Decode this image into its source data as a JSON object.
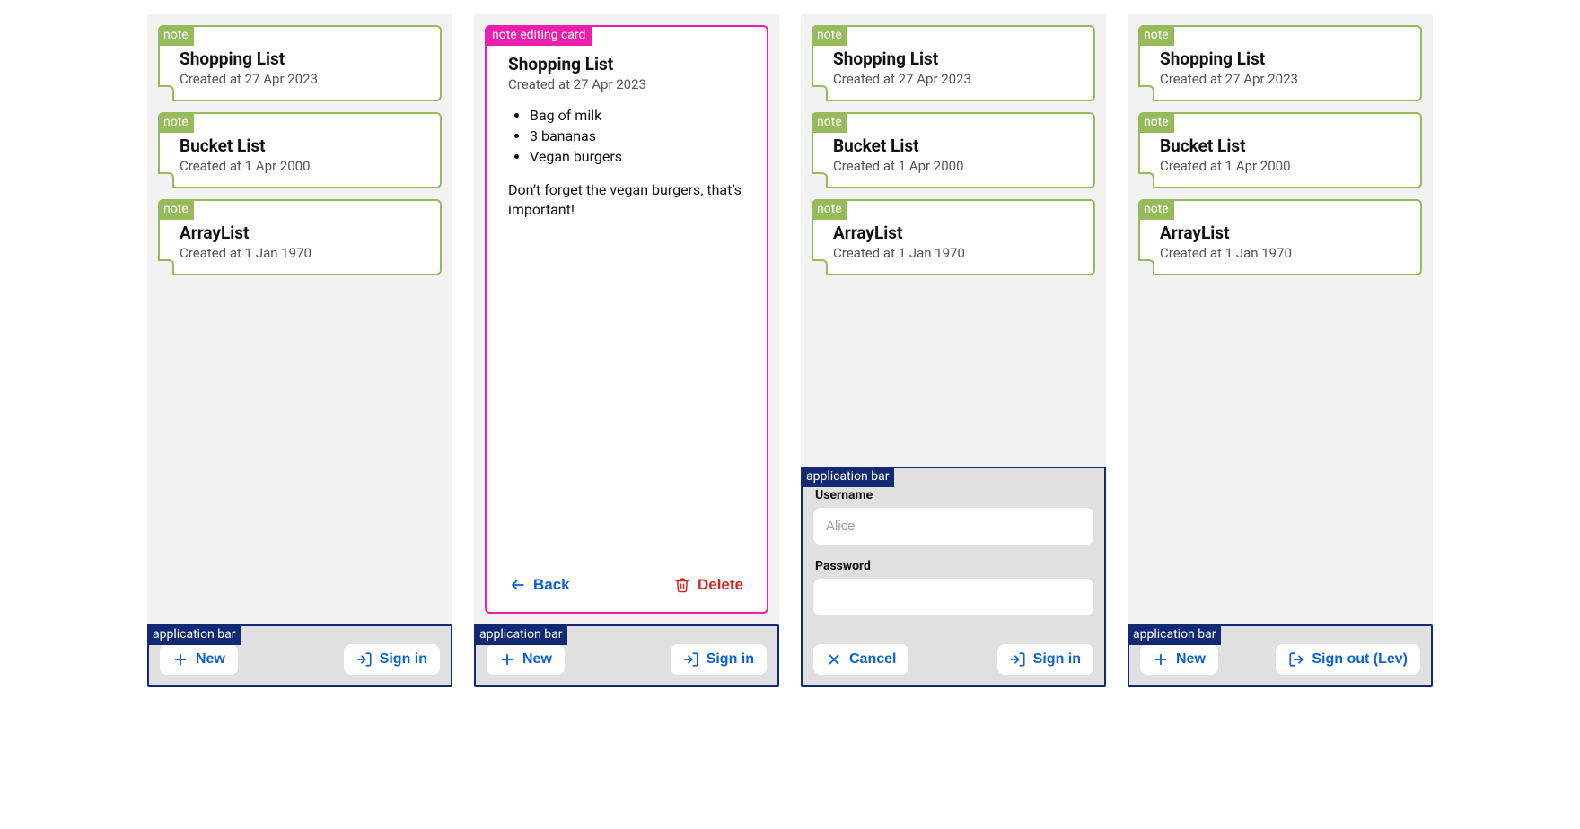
{
  "tags": {
    "note": "note",
    "editing": "note editing card",
    "appbar": "application bar"
  },
  "notes": [
    {
      "title": "Shopping List",
      "meta": "Created at 27 Apr 2023"
    },
    {
      "title": "Bucket List",
      "meta": "Created at 1 Apr 2000"
    },
    {
      "title": "ArrayList",
      "meta": "Created at 1 Jan 1970"
    }
  ],
  "editing": {
    "title": "Shopping List",
    "meta": "Created at 27 Apr 2023",
    "items": [
      "Bag of milk",
      "3 bananas",
      "Vegan burgers"
    ],
    "footnote": "Don’t forget the vegan burgers, that’s important!",
    "back": "Back",
    "delete": "Delete"
  },
  "login": {
    "username_label": "Username",
    "username_placeholder": "Alice",
    "password_label": "Password",
    "cancel": "Cancel",
    "signin": "Sign in"
  },
  "bar": {
    "new": "New",
    "signin": "Sign in",
    "signout": "Sign out (Lev)"
  }
}
